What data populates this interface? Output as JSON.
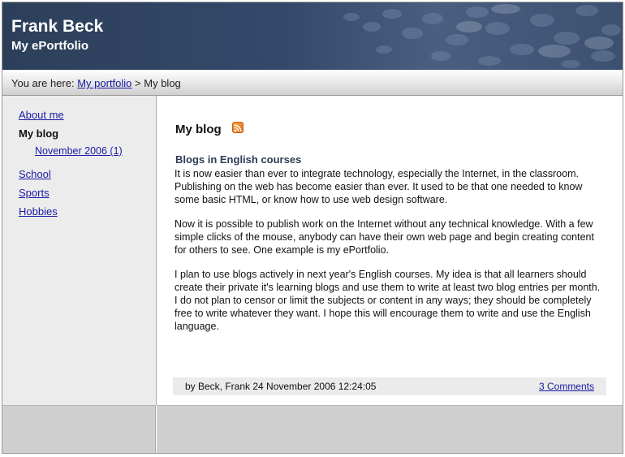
{
  "header": {
    "title": "Frank Beck",
    "subtitle": "My ePortfolio"
  },
  "breadcrumb": {
    "prefix": "You are here:",
    "link": "My portfolio",
    "separator": ">",
    "current": "My blog"
  },
  "sidebar": {
    "items": [
      {
        "label": "About me"
      },
      {
        "label": "My blog"
      },
      {
        "label": "November 2006 (1)"
      },
      {
        "label": "School"
      },
      {
        "label": "Sports"
      },
      {
        "label": "Hobbies"
      }
    ]
  },
  "main": {
    "title": "My blog",
    "feed_icon": "rss-icon",
    "post": {
      "title": "Blogs in English courses",
      "paragraphs": [
        "It is now easier than ever to integrate technology, especially the Internet, in the classroom. Publishing on the web has become easier than ever. It used to be that one needed to know some basic HTML, or know how to use web design software.",
        "Now it is possible to publish work on the Internet without any technical knowledge. With a few simple clicks of the mouse, anybody can have their own web page and begin creating content for others to see. One example is my ePortfolio.",
        "I plan to use blogs actively in next year's English courses. My idea is that all learners should create their private it's learning blogs and use them to write at least two blog entries per month. I do not plan to censor or limit the subjects or content in any ways; they should be completely free to write whatever they want. I hope this will encourage them to write and use the English language."
      ],
      "byline": "by Beck, Frank 24 November 2006 12:24:05",
      "comments": "3 Comments"
    }
  },
  "colors": {
    "header_bg": "#34496a",
    "link": "#1a1aa6",
    "post_title": "#2b3c55",
    "sidebar_bg": "#ececec",
    "rss": "#f08a2c"
  }
}
